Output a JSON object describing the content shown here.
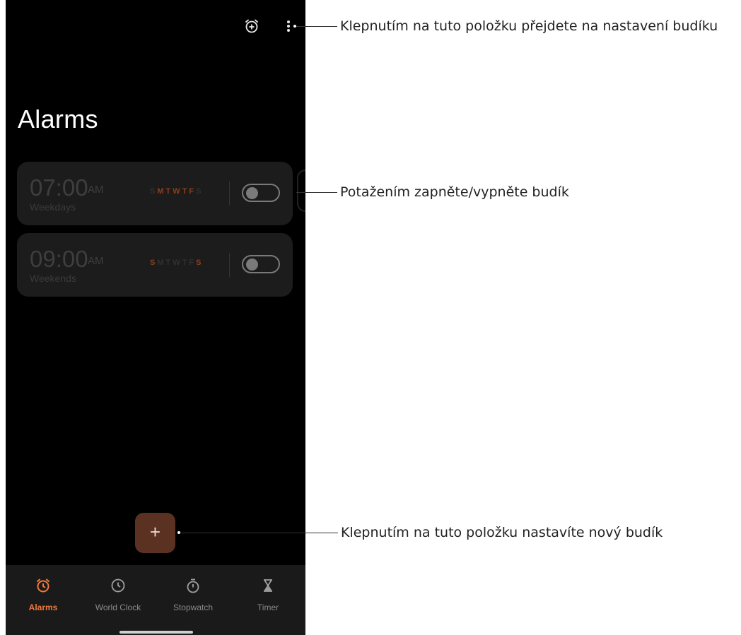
{
  "header": {
    "title": "Alarms"
  },
  "alarms": [
    {
      "time": "07:00",
      "ampm": "AM",
      "label": "Weekdays",
      "days": [
        {
          "letter": "S",
          "active": false
        },
        {
          "letter": "M",
          "active": true
        },
        {
          "letter": "T",
          "active": true
        },
        {
          "letter": "W",
          "active": true
        },
        {
          "letter": "T",
          "active": true
        },
        {
          "letter": "F",
          "active": true
        },
        {
          "letter": "S",
          "active": false
        }
      ],
      "enabled": false
    },
    {
      "time": "09:00",
      "ampm": "AM",
      "label": "Weekends",
      "days": [
        {
          "letter": "S",
          "active": true
        },
        {
          "letter": "M",
          "active": false
        },
        {
          "letter": "T",
          "active": false
        },
        {
          "letter": "W",
          "active": false
        },
        {
          "letter": "T",
          "active": false
        },
        {
          "letter": "F",
          "active": false
        },
        {
          "letter": "S",
          "active": true
        }
      ],
      "enabled": false
    }
  ],
  "fab": {
    "symbol": "+"
  },
  "nav": {
    "items": [
      {
        "label": "Alarms",
        "icon": "alarm-clock-icon",
        "active": true
      },
      {
        "label": "World Clock",
        "icon": "clock-icon",
        "active": false
      },
      {
        "label": "Stopwatch",
        "icon": "stopwatch-icon",
        "active": false
      },
      {
        "label": "Timer",
        "icon": "hourglass-icon",
        "active": false
      }
    ]
  },
  "callouts": {
    "settings": "Klepnutím na tuto položku přejdete na nastavení budíku",
    "toggle": "Potažením zapněte/vypněte budík",
    "add": "Klepnutím na tuto položku nastavíte nový budík"
  },
  "colors": {
    "accent": "#f07a3c",
    "active_day": "#8a3f1c",
    "fab": "#5b3222",
    "background": "#000000",
    "card": "#1c1c1c"
  }
}
